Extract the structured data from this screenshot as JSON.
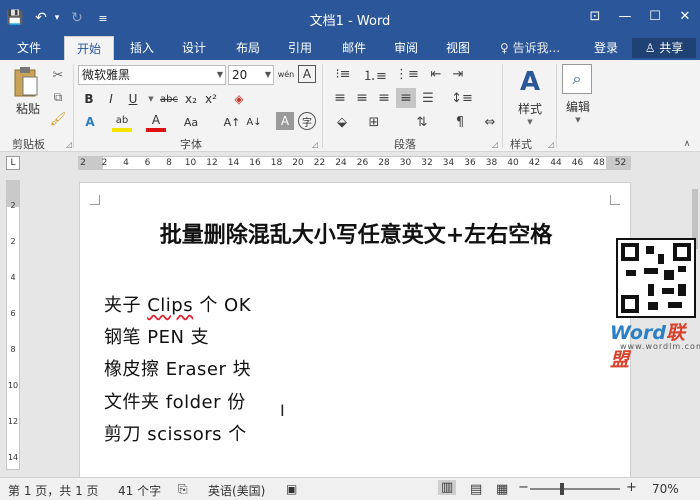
{
  "titlebar": {
    "title": "文档1 - Word",
    "qat": [
      "💾",
      "↶",
      "▾",
      "↻",
      "≡"
    ],
    "controls": [
      "⊡",
      "—",
      "☐",
      "✕"
    ]
  },
  "tabs": [
    {
      "label": "文件",
      "active": false
    },
    {
      "label": "开始",
      "active": true
    },
    {
      "label": "插入",
      "active": false
    },
    {
      "label": "设计",
      "active": false
    },
    {
      "label": "布局",
      "active": false
    },
    {
      "label": "引用",
      "active": false
    },
    {
      "label": "邮件",
      "active": false
    },
    {
      "label": "审阅",
      "active": false
    },
    {
      "label": "视图",
      "active": false
    }
  ],
  "tellme": "♀ 告诉我...",
  "signin": "登录",
  "share": "♙ 共享",
  "ribbon": {
    "clipboard": {
      "paste": "粘贴",
      "label": "剪贴板"
    },
    "font": {
      "name": "微软雅黑",
      "size": "20",
      "label": "字体",
      "row1": [
        "wén",
        "A"
      ],
      "row2": [
        "B",
        "I",
        "U",
        "abc",
        "x₂",
        "x²",
        "◈"
      ],
      "row3": [
        "A",
        "ab",
        "A",
        "Aa",
        "A↑",
        "A↓",
        "A",
        "字"
      ]
    },
    "paragraph": {
      "label": "段落"
    },
    "styles": {
      "button": "样式",
      "label": "样式"
    },
    "editing": {
      "button": "编辑"
    }
  },
  "ruler": {
    "corner": "L",
    "ticks": [
      "2",
      "2",
      "4",
      "6",
      "8",
      "10",
      "12",
      "14",
      "16",
      "18",
      "20",
      "22",
      "24",
      "26",
      "28",
      "30",
      "32",
      "34",
      "36",
      "38",
      "40",
      "42",
      "44",
      "46",
      "48",
      "52"
    ],
    "left_ticks": [
      "2",
      "2",
      "4",
      "6",
      "8",
      "10",
      "12",
      "14"
    ]
  },
  "document": {
    "title": "批量删除混乱大小写任意英文+左右空格",
    "lines": [
      {
        "pre": "夹子 ",
        "word": "Clips",
        "post": " 个 OK",
        "squiggle": true
      },
      {
        "pre": "钢笔 ",
        "word": "PEN",
        "post": " 支",
        "squiggle": false
      },
      {
        "pre": "橡皮擦 ",
        "word": "Eraser",
        "post": " 块",
        "squiggle": false
      },
      {
        "pre": "文件夹 ",
        "word": "folder",
        "post": " 份",
        "squiggle": false
      },
      {
        "pre": "剪刀 ",
        "word": "scissors",
        "post": " 个",
        "squiggle": false
      }
    ]
  },
  "watermark": {
    "brand": "Word",
    "brand_cn": "联盟",
    "url": "www.wordlm.com"
  },
  "status": {
    "page": "第 1 页，共 1 页",
    "words": "41 个字",
    "language": "英语(美国)",
    "zoom": "70%"
  }
}
